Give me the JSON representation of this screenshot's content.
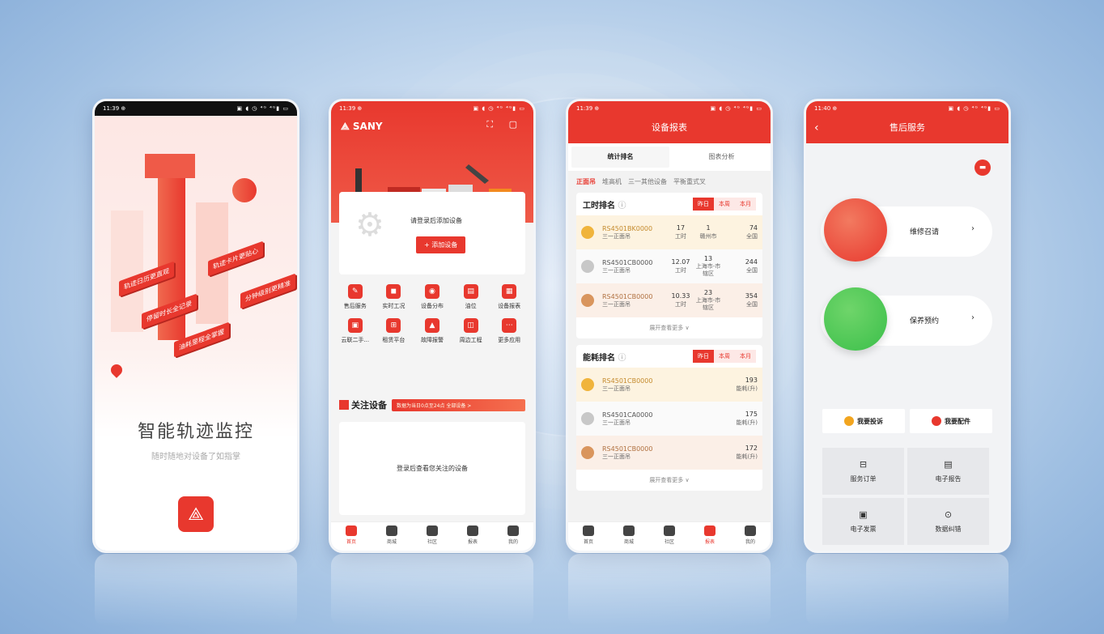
{
  "phone1": {
    "status": {
      "time": "11:39 ⊕",
      "icons": "▣ ◖ ◷ ⁴ᴳ ⁴ᴳ▮ ▭"
    },
    "tags": [
      "轨迹日历更直观",
      "停留时长全记录",
      "油耗里程全掌握",
      "轨迹卡片更贴心",
      "分钟级别更精准"
    ],
    "title": "智能轨迹监控",
    "subtitle": "随时随地对设备了如指掌",
    "logo_icon": "sany-logo"
  },
  "phone2": {
    "status": {
      "time": "11:39 ⊕",
      "icons": "▣ ◖ ◷ ⁴ᴳ ⁴ᴳ▮ ▭"
    },
    "brand": "SANY",
    "header_icons": "⛶ ▢",
    "login_prompt": "请登录后添加设备",
    "add_button": "+ 添加设备",
    "grid": [
      "售后服务",
      "实时工况",
      "设备分布",
      "油位",
      "设备报表",
      "云联二手...",
      "租赁平台",
      "故障报警",
      "周边工程",
      "更多应用"
    ],
    "grid_icons": [
      "✎",
      "◼",
      "◉",
      "▤",
      "▦",
      "▣",
      "⊞",
      "▲",
      "◫",
      "⋯"
    ],
    "follow_title": "关注设备",
    "follow_pill": "数据为当日0点至24点    全部设备 >",
    "follow_empty": "登录后查看您关注的设备",
    "tabs": [
      "首页",
      "商城",
      "社区",
      "报表",
      "我的"
    ],
    "active_tab": 0
  },
  "phone3": {
    "status": {
      "time": "11:39 ⊕",
      "icons": "▣ ◖ ◷ ⁴ᴳ ⁴ᴳ▮ ▭"
    },
    "title": "设备报表",
    "subtabs": [
      "统计排名",
      "图表分析"
    ],
    "categories": [
      "正面吊",
      "堆高机",
      "三一其他设备",
      "平衡重式叉"
    ],
    "hours": {
      "title": "工时排名",
      "segments": [
        "昨日",
        "本周",
        "本月"
      ],
      "rows": [
        {
          "id": "RS4501BK0000",
          "type": "三一正面吊",
          "v1": "17",
          "l1": "工时",
          "v2": "1",
          "l2": "赣州市",
          "v3": "74",
          "l3": "全国"
        },
        {
          "id": "RS4501CB0000",
          "type": "三一正面吊",
          "v1": "12.07",
          "l1": "工时",
          "v2": "13",
          "l2": "上海市-市辖区",
          "v3": "244",
          "l3": "全国"
        },
        {
          "id": "RS4501CB0000",
          "type": "三一正面吊",
          "v1": "10.33",
          "l1": "工时",
          "v2": "23",
          "l2": "上海市-市辖区",
          "v3": "354",
          "l3": "全国"
        }
      ],
      "more": "展开查看更多 ∨"
    },
    "fuel": {
      "title": "能耗排名",
      "segments": [
        "昨日",
        "本周",
        "本月"
      ],
      "rows": [
        {
          "id": "RS4501CB0000",
          "type": "三一正面吊",
          "v": "193",
          "l": "能耗(升)"
        },
        {
          "id": "RS4501CA0000",
          "type": "三一正面吊",
          "v": "175",
          "l": "能耗(升)"
        },
        {
          "id": "RS4501CB0000",
          "type": "三一正面吊",
          "v": "172",
          "l": "能耗(升)"
        }
      ],
      "more": "展开查看更多 ∨"
    },
    "tabs": [
      "首页",
      "商城",
      "社区",
      "报表",
      "我的"
    ],
    "active_tab": 3
  },
  "phone4": {
    "status": {
      "time": "11:40 ⊕",
      "icons": "▣ ◖ ◷ ⁴ᴳ ⁴ᴳ▮ ▭"
    },
    "title": "售后服务",
    "back": "‹",
    "chat_icon": "▬",
    "services": [
      {
        "label": "维修召请",
        "color": "#e8382e"
      },
      {
        "label": "保养预约",
        "color": "#3bbf4a"
      }
    ],
    "arrow": "›",
    "quick": [
      {
        "label": "我要投诉",
        "color": "#f2a51f"
      },
      {
        "label": "我要配件",
        "color": "#e8382e"
      }
    ],
    "tiles": [
      {
        "label": "服务订单",
        "icon": "⊟"
      },
      {
        "label": "电子报告",
        "icon": "▤"
      },
      {
        "label": "电子发票",
        "icon": "▣"
      },
      {
        "label": "数据纠错",
        "icon": "⊙"
      }
    ]
  }
}
